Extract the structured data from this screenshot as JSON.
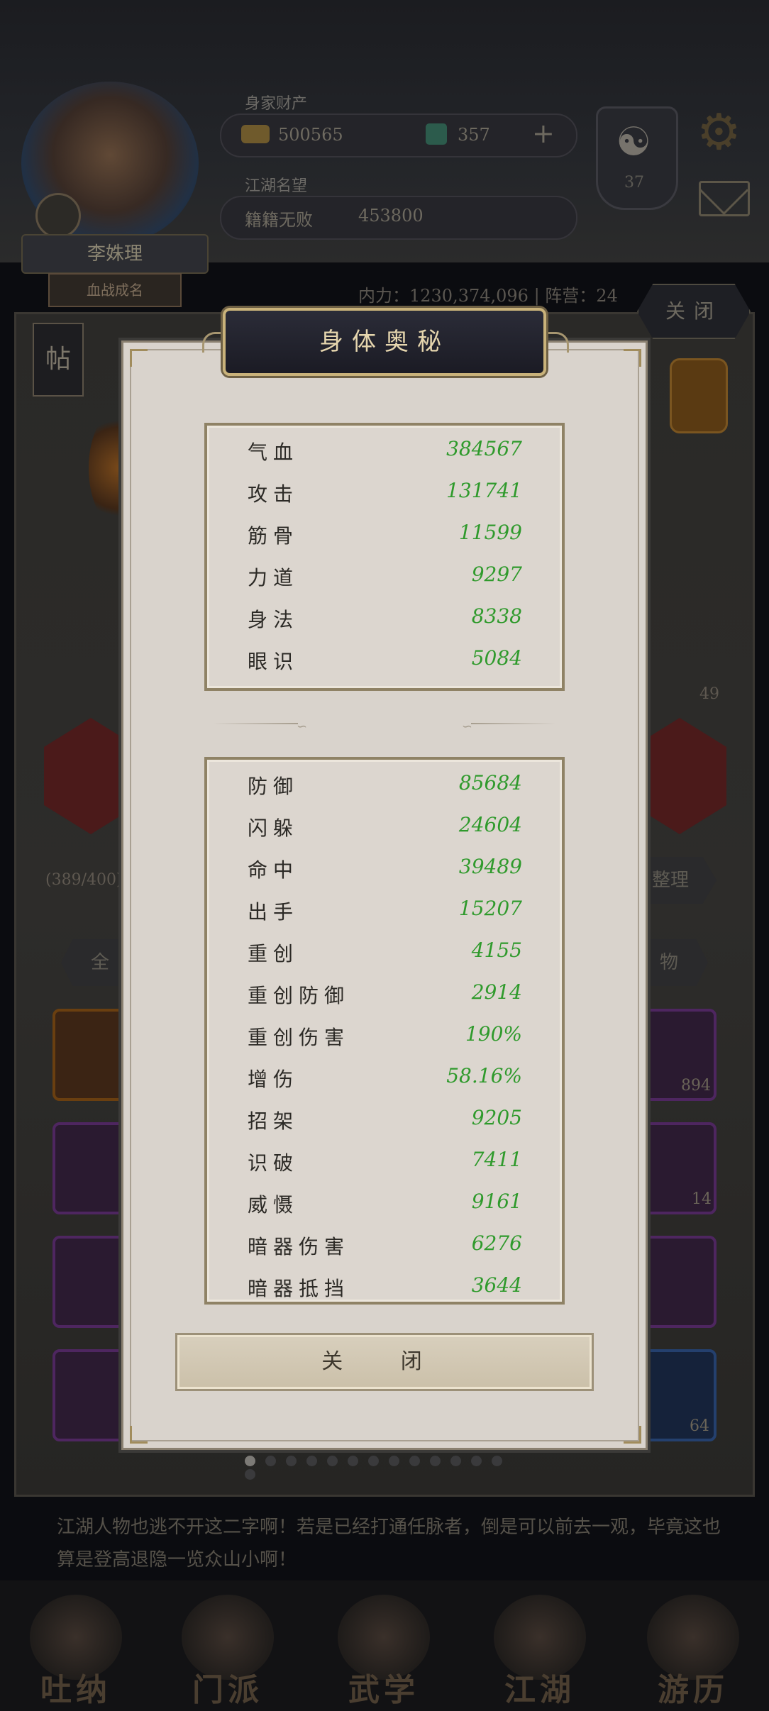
{
  "header": {
    "wealth_label": "身家财产",
    "coins": "500565",
    "jade": "357",
    "plus": "+",
    "reputation_label": "江湖名望",
    "rank_name": "籍籍无败",
    "rank_value": "453800",
    "taiji_symbol": "☯",
    "taiji_count": "37",
    "gear_symbol": "⚙"
  },
  "character": {
    "name": "李姝理",
    "title": "血战成名",
    "power_text": "内力：1230,374,096 | 阵营：24"
  },
  "background": {
    "close_label": "关闭",
    "post_label": "帖",
    "count_label": "(389/400)",
    "level": "49",
    "sort_label": "整理",
    "tab_all": "全",
    "tab_items": "物",
    "slot_counts": [
      "894",
      "14",
      "",
      "64"
    ],
    "description": "江湖人物也逃不开这二字啊！若是已经打通任脉者，倒是可以前去一观，毕竟这也算是登高退隐一览众山小啊！",
    "nav": [
      "吐纳",
      "门派",
      "武学",
      "江湖",
      "游历"
    ],
    "pages": 14,
    "active_page": 1
  },
  "modal": {
    "title": "身体奥秘",
    "panel1": [
      {
        "name": "气血",
        "value": "384567"
      },
      {
        "name": "攻击",
        "value": "131741"
      },
      {
        "name": "筋骨",
        "value": "11599"
      },
      {
        "name": "力道",
        "value": "9297"
      },
      {
        "name": "身法",
        "value": "8338"
      },
      {
        "name": "眼识",
        "value": "5084"
      }
    ],
    "panel2": [
      {
        "name": "防御",
        "value": "85684"
      },
      {
        "name": "闪躲",
        "value": "24604"
      },
      {
        "name": "命中",
        "value": "39489"
      },
      {
        "name": "出手",
        "value": "15207"
      },
      {
        "name": "重创",
        "value": "4155"
      },
      {
        "name": "重创防御",
        "value": "2914"
      },
      {
        "name": "重创伤害",
        "value": "190%"
      },
      {
        "name": "增伤",
        "value": "58.16%"
      },
      {
        "name": "招架",
        "value": "9205"
      },
      {
        "name": "识破",
        "value": "7411"
      },
      {
        "name": "威慑",
        "value": "9161"
      },
      {
        "name": "暗器伤害",
        "value": "6276"
      },
      {
        "name": "暗器抵挡",
        "value": "3644"
      }
    ],
    "close_button": "关  闭"
  },
  "colors": {
    "stat_value_green": "#2f9a2c",
    "title_gold": "#e6d6ae",
    "modal_bg": "#d9d3cc"
  }
}
